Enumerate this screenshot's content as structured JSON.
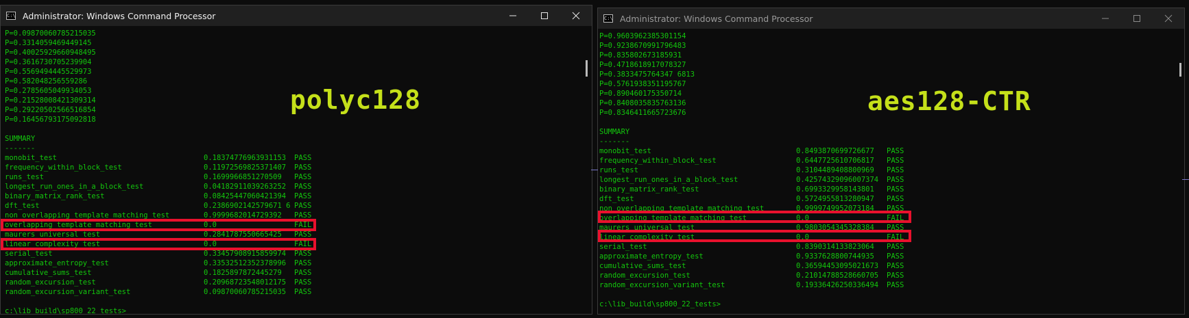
{
  "left": {
    "title": "Administrator: Windows Command Processor",
    "label": "polyc128",
    "p_values": [
      "P=0.09870060785215035",
      "P=0.3314059469449145",
      "P=0.40025929660948495",
      "P=0.3616730705239904",
      "P=0.5569494445529973",
      "P=0.582048256559286",
      "P=0.2785605049934053",
      "P=0.21528008421309314",
      "P=0.29220502566516854",
      "P=0.16456793175092818"
    ],
    "summary_title": "SUMMARY",
    "separator": "-------",
    "results": [
      {
        "name": "monobit_test",
        "value": "0.18374776963931153",
        "result": "PASS"
      },
      {
        "name": "frequency_within_block_test",
        "value": "0.11972569825371407",
        "result": "PASS"
      },
      {
        "name": "runs_test",
        "value": "0.1699966851270509",
        "result": "PASS"
      },
      {
        "name": "longest_run_ones_in_a_block_test",
        "value": "0.04182911039263252",
        "result": "PASS"
      },
      {
        "name": "binary_matrix_rank_test",
        "value": "0.08425447060421394",
        "result": "PASS"
      },
      {
        "name": "dft_test",
        "value": "0.2386902142579671 6",
        "result": "PASS"
      },
      {
        "name": "non_overlapping_template_matching_test",
        "value": "0.9999682014729392",
        "result": "PASS"
      },
      {
        "name": "overlapping_template_matching_test",
        "value": "0.0",
        "result": "FAIL"
      },
      {
        "name": "maurers_universal_test",
        "value": "0.2841787550665425",
        "result": "PASS"
      },
      {
        "name": "linear_complexity_test",
        "value": "0.0",
        "result": "FAIL"
      },
      {
        "name": "serial_test",
        "value": "0.33457908915859974",
        "result": "PASS"
      },
      {
        "name": "approximate_entropy_test",
        "value": "0.33532512352378996",
        "result": "PASS"
      },
      {
        "name": "cumulative_sums_test",
        "value": "0.1825897872445279",
        "result": "PASS"
      },
      {
        "name": "random_excursion_test",
        "value": "0.20968723548012175",
        "result": "PASS"
      },
      {
        "name": "random_excursion_variant_test",
        "value": "0.09870060785215035",
        "result": "PASS"
      }
    ],
    "prompt": "c:\\lib_build\\sp800_22_tests>"
  },
  "right": {
    "title": "Administrator: Windows Command Processor",
    "label": "aes128-CTR",
    "p_values": [
      "P=0.9603962385301154",
      "P=0.9238670991796483",
      "P=0.835802673185931",
      "P=0.4718618917078327",
      "P=0.3833475764347 6813",
      "P=0.5761938351195767",
      "P=0.890460175350714",
      "P=0.8408035835763136",
      "P=0.8346411665723676"
    ],
    "summary_title": "SUMMARY",
    "separator": "-------",
    "results": [
      {
        "name": "monobit_test",
        "value": "0.8493870699726677",
        "result": "PASS"
      },
      {
        "name": "frequency_within_block_test",
        "value": "0.6447725610706817",
        "result": "PASS"
      },
      {
        "name": "runs_test",
        "value": "0.3104489408800969",
        "result": "PASS"
      },
      {
        "name": "longest_run_ones_in_a_block_test",
        "value": "0.42574329096007374",
        "result": "PASS"
      },
      {
        "name": "binary_matrix_rank_test",
        "value": "0.6993329958143801",
        "result": "PASS"
      },
      {
        "name": "dft_test",
        "value": "0.5724955813280947",
        "result": "PASS"
      },
      {
        "name": "non_overlapping_template_matching_test",
        "value": "0.9999749952073184",
        "result": "PASS"
      },
      {
        "name": "overlapping_template_matching_test",
        "value": "0.0",
        "result": "FAIL"
      },
      {
        "name": "maurers_universal_test",
        "value": "0.9803054345328384",
        "result": "PASS"
      },
      {
        "name": "linear_complexity_test",
        "value": "0.0",
        "result": "FAIL"
      },
      {
        "name": "serial_test",
        "value": "0.8390314133823064",
        "result": "PASS"
      },
      {
        "name": "approximate_entropy_test",
        "value": "0.9337628800744935",
        "result": "PASS"
      },
      {
        "name": "cumulative_sums_test",
        "value": "0.36594453095021673",
        "result": "PASS"
      },
      {
        "name": "random_excursion_test",
        "value": "0.21014788528660705",
        "result": "PASS"
      },
      {
        "name": "random_excursion_variant_test",
        "value": "0.19336426250336494",
        "result": "PASS"
      }
    ],
    "prompt": "c:\\lib_build\\sp800_22_tests>"
  },
  "colors": {
    "console_text": "#13c60d",
    "label": "#c5e01a",
    "highlight": "#e8112d",
    "titlebar": "#202020",
    "background": "#0c0c0c"
  },
  "icons": {
    "window": "cmd-icon",
    "minimize": "minimize-icon",
    "maximize": "maximize-icon",
    "close": "close-icon"
  }
}
